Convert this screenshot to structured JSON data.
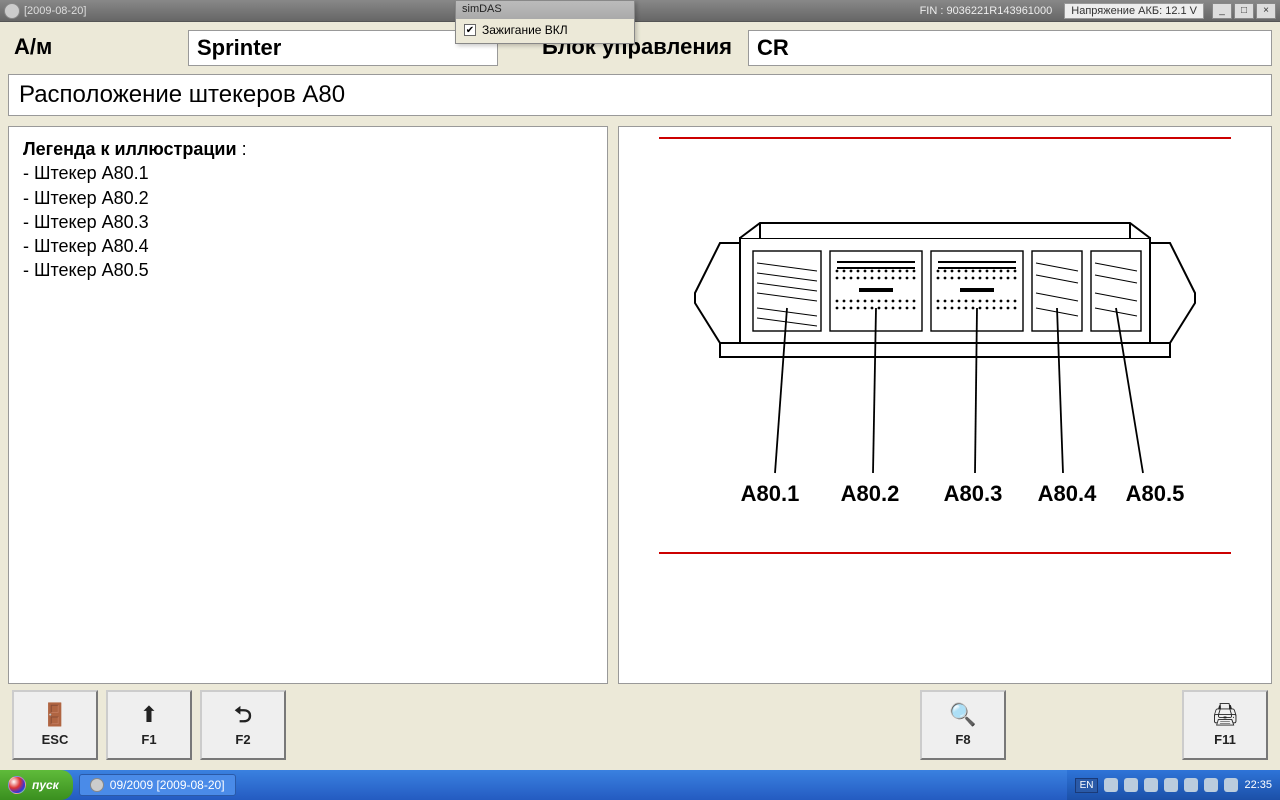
{
  "titlebar": {
    "date_text": "[2009-08-20]",
    "fin_label": "FIN : 9036221R143961000",
    "voltage_label": "Напряжение АКБ: 12.1 V"
  },
  "overlay": {
    "title": "simDAS",
    "checkbox_label": "Зажигание ВКЛ",
    "checked": true
  },
  "header": {
    "vehicle_label": "А/м",
    "vehicle_value": "Sprinter",
    "ecu_label": "Блок управления",
    "ecu_value": "CR"
  },
  "section_title": "Расположение штекеров A80",
  "legend": {
    "title": "Легенда к иллюстрации",
    "items": [
      "Штекер A80.1",
      "Штекер A80.2",
      "Штекер A80.3",
      "Штекер A80.4",
      "Штекер A80.5"
    ]
  },
  "diagram_labels": [
    "A80.1",
    "A80.2",
    "A80.3",
    "A80.4",
    "A80.5"
  ],
  "fn_buttons": {
    "esc": "ESC",
    "f1": "F1",
    "f2": "F2",
    "f8": "F8",
    "f11": "F11"
  },
  "taskbar": {
    "start_label": "пуск",
    "task_item": "09/2009 [2009-08-20]",
    "lang": "EN",
    "clock": "22:35"
  }
}
